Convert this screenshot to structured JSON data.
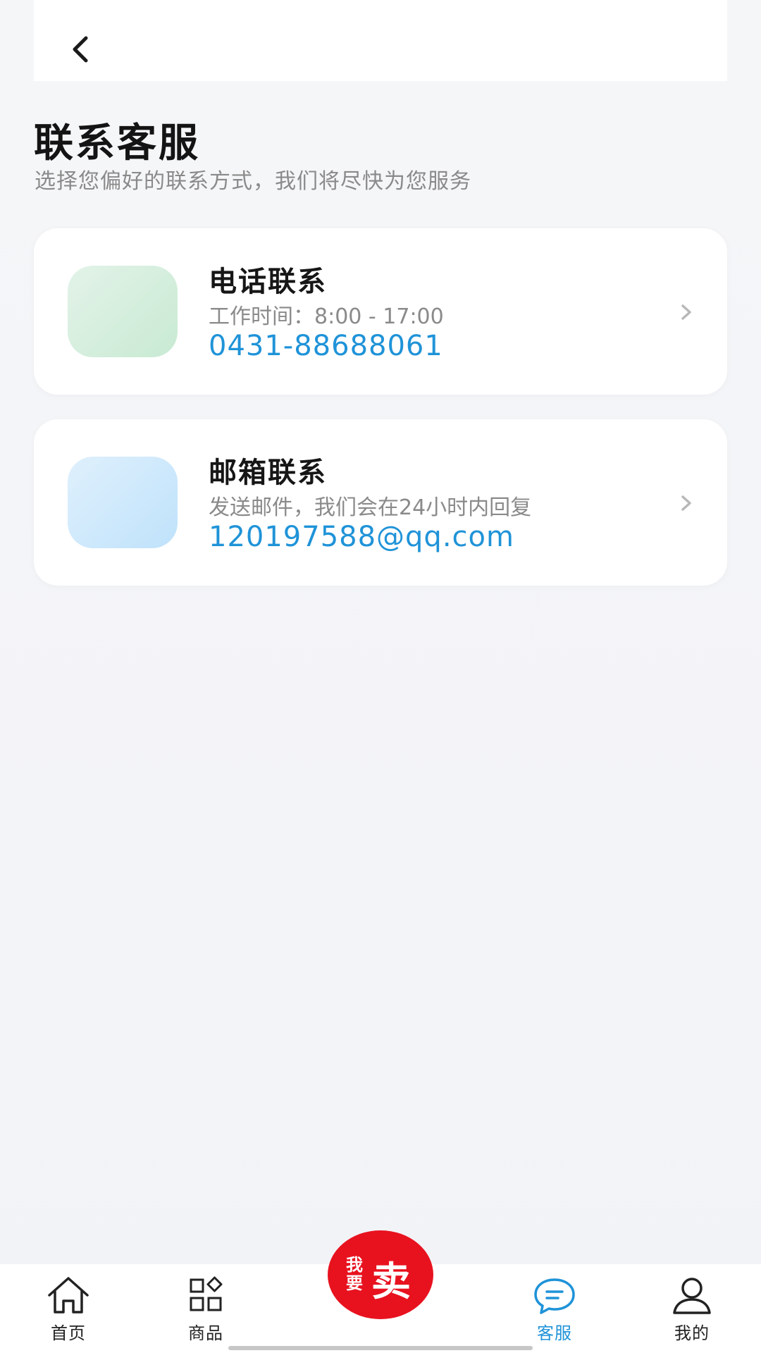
{
  "header": {
    "back_icon": "chevron-left-icon"
  },
  "page": {
    "title": "联系客服",
    "subtitle": "选择您偏好的联系方式，我们将尽快为您服务"
  },
  "contacts": {
    "phone": {
      "title": "电话联系",
      "desc": "工作时间：8:00 - 17:00",
      "value": "0431-88688061",
      "icon": "phone-icon"
    },
    "email": {
      "title": "邮箱联系",
      "desc": "发送邮件，我们会在24小时内回复",
      "value": "120197588@qq.com",
      "icon": "mail-icon"
    }
  },
  "tabbar": {
    "home": "首页",
    "products": "商品",
    "sell_small": "我要",
    "sell_big": "卖",
    "service": "客服",
    "mine": "我的",
    "active": "service"
  },
  "colors": {
    "accent": "#1f93d8",
    "sell": "#e8121f"
  }
}
